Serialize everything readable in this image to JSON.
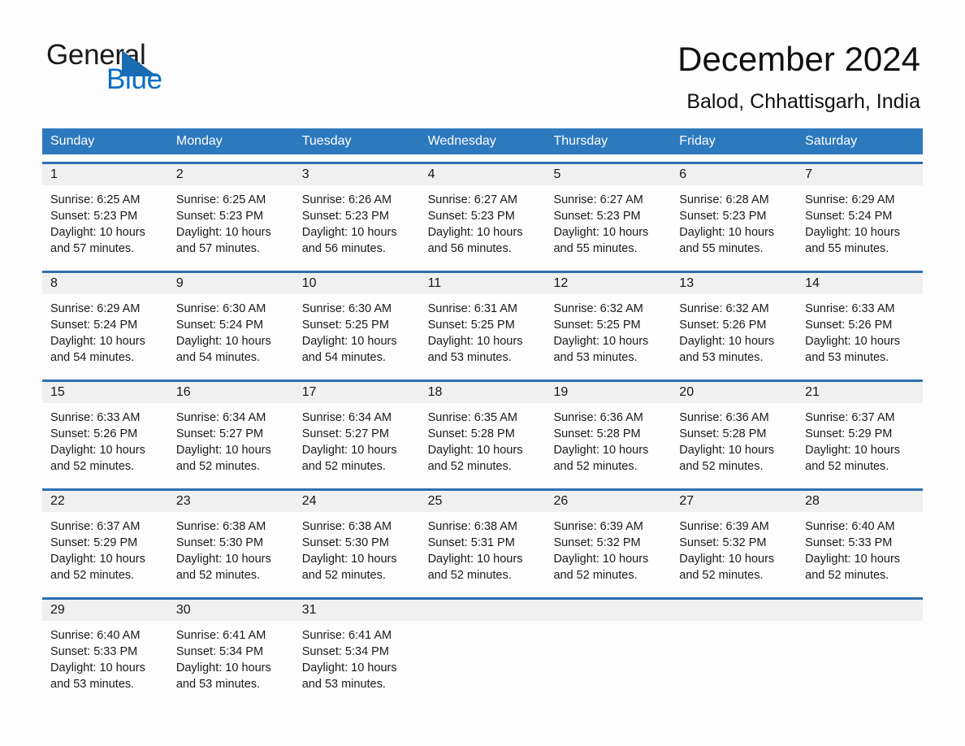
{
  "brand": {
    "name_part1": "General",
    "name_part2": "Blue"
  },
  "header": {
    "title": "December 2024",
    "location": "Balod, Chhattisgarh, India"
  },
  "calendar": {
    "weekdays": [
      "Sunday",
      "Monday",
      "Tuesday",
      "Wednesday",
      "Thursday",
      "Friday",
      "Saturday"
    ],
    "accent_color": "#2d79bd",
    "row_border_color": "#2d6faf",
    "daynum_bg": "#f0f0f0",
    "weeks": [
      {
        "daynums": [
          "1",
          "2",
          "3",
          "4",
          "5",
          "6",
          "7"
        ],
        "days": [
          {
            "sunrise": "Sunrise: 6:25 AM",
            "sunset": "Sunset: 5:23 PM",
            "daylight1": "Daylight: 10 hours",
            "daylight2": "and 57 minutes."
          },
          {
            "sunrise": "Sunrise: 6:25 AM",
            "sunset": "Sunset: 5:23 PM",
            "daylight1": "Daylight: 10 hours",
            "daylight2": "and 57 minutes."
          },
          {
            "sunrise": "Sunrise: 6:26 AM",
            "sunset": "Sunset: 5:23 PM",
            "daylight1": "Daylight: 10 hours",
            "daylight2": "and 56 minutes."
          },
          {
            "sunrise": "Sunrise: 6:27 AM",
            "sunset": "Sunset: 5:23 PM",
            "daylight1": "Daylight: 10 hours",
            "daylight2": "and 56 minutes."
          },
          {
            "sunrise": "Sunrise: 6:27 AM",
            "sunset": "Sunset: 5:23 PM",
            "daylight1": "Daylight: 10 hours",
            "daylight2": "and 55 minutes."
          },
          {
            "sunrise": "Sunrise: 6:28 AM",
            "sunset": "Sunset: 5:23 PM",
            "daylight1": "Daylight: 10 hours",
            "daylight2": "and 55 minutes."
          },
          {
            "sunrise": "Sunrise: 6:29 AM",
            "sunset": "Sunset: 5:24 PM",
            "daylight1": "Daylight: 10 hours",
            "daylight2": "and 55 minutes."
          }
        ]
      },
      {
        "daynums": [
          "8",
          "9",
          "10",
          "11",
          "12",
          "13",
          "14"
        ],
        "days": [
          {
            "sunrise": "Sunrise: 6:29 AM",
            "sunset": "Sunset: 5:24 PM",
            "daylight1": "Daylight: 10 hours",
            "daylight2": "and 54 minutes."
          },
          {
            "sunrise": "Sunrise: 6:30 AM",
            "sunset": "Sunset: 5:24 PM",
            "daylight1": "Daylight: 10 hours",
            "daylight2": "and 54 minutes."
          },
          {
            "sunrise": "Sunrise: 6:30 AM",
            "sunset": "Sunset: 5:25 PM",
            "daylight1": "Daylight: 10 hours",
            "daylight2": "and 54 minutes."
          },
          {
            "sunrise": "Sunrise: 6:31 AM",
            "sunset": "Sunset: 5:25 PM",
            "daylight1": "Daylight: 10 hours",
            "daylight2": "and 53 minutes."
          },
          {
            "sunrise": "Sunrise: 6:32 AM",
            "sunset": "Sunset: 5:25 PM",
            "daylight1": "Daylight: 10 hours",
            "daylight2": "and 53 minutes."
          },
          {
            "sunrise": "Sunrise: 6:32 AM",
            "sunset": "Sunset: 5:26 PM",
            "daylight1": "Daylight: 10 hours",
            "daylight2": "and 53 minutes."
          },
          {
            "sunrise": "Sunrise: 6:33 AM",
            "sunset": "Sunset: 5:26 PM",
            "daylight1": "Daylight: 10 hours",
            "daylight2": "and 53 minutes."
          }
        ]
      },
      {
        "daynums": [
          "15",
          "16",
          "17",
          "18",
          "19",
          "20",
          "21"
        ],
        "days": [
          {
            "sunrise": "Sunrise: 6:33 AM",
            "sunset": "Sunset: 5:26 PM",
            "daylight1": "Daylight: 10 hours",
            "daylight2": "and 52 minutes."
          },
          {
            "sunrise": "Sunrise: 6:34 AM",
            "sunset": "Sunset: 5:27 PM",
            "daylight1": "Daylight: 10 hours",
            "daylight2": "and 52 minutes."
          },
          {
            "sunrise": "Sunrise: 6:34 AM",
            "sunset": "Sunset: 5:27 PM",
            "daylight1": "Daylight: 10 hours",
            "daylight2": "and 52 minutes."
          },
          {
            "sunrise": "Sunrise: 6:35 AM",
            "sunset": "Sunset: 5:28 PM",
            "daylight1": "Daylight: 10 hours",
            "daylight2": "and 52 minutes."
          },
          {
            "sunrise": "Sunrise: 6:36 AM",
            "sunset": "Sunset: 5:28 PM",
            "daylight1": "Daylight: 10 hours",
            "daylight2": "and 52 minutes."
          },
          {
            "sunrise": "Sunrise: 6:36 AM",
            "sunset": "Sunset: 5:28 PM",
            "daylight1": "Daylight: 10 hours",
            "daylight2": "and 52 minutes."
          },
          {
            "sunrise": "Sunrise: 6:37 AM",
            "sunset": "Sunset: 5:29 PM",
            "daylight1": "Daylight: 10 hours",
            "daylight2": "and 52 minutes."
          }
        ]
      },
      {
        "daynums": [
          "22",
          "23",
          "24",
          "25",
          "26",
          "27",
          "28"
        ],
        "days": [
          {
            "sunrise": "Sunrise: 6:37 AM",
            "sunset": "Sunset: 5:29 PM",
            "daylight1": "Daylight: 10 hours",
            "daylight2": "and 52 minutes."
          },
          {
            "sunrise": "Sunrise: 6:38 AM",
            "sunset": "Sunset: 5:30 PM",
            "daylight1": "Daylight: 10 hours",
            "daylight2": "and 52 minutes."
          },
          {
            "sunrise": "Sunrise: 6:38 AM",
            "sunset": "Sunset: 5:30 PM",
            "daylight1": "Daylight: 10 hours",
            "daylight2": "and 52 minutes."
          },
          {
            "sunrise": "Sunrise: 6:38 AM",
            "sunset": "Sunset: 5:31 PM",
            "daylight1": "Daylight: 10 hours",
            "daylight2": "and 52 minutes."
          },
          {
            "sunrise": "Sunrise: 6:39 AM",
            "sunset": "Sunset: 5:32 PM",
            "daylight1": "Daylight: 10 hours",
            "daylight2": "and 52 minutes."
          },
          {
            "sunrise": "Sunrise: 6:39 AM",
            "sunset": "Sunset: 5:32 PM",
            "daylight1": "Daylight: 10 hours",
            "daylight2": "and 52 minutes."
          },
          {
            "sunrise": "Sunrise: 6:40 AM",
            "sunset": "Sunset: 5:33 PM",
            "daylight1": "Daylight: 10 hours",
            "daylight2": "and 52 minutes."
          }
        ]
      },
      {
        "daynums": [
          "29",
          "30",
          "31",
          "",
          "",
          "",
          ""
        ],
        "days": [
          {
            "sunrise": "Sunrise: 6:40 AM",
            "sunset": "Sunset: 5:33 PM",
            "daylight1": "Daylight: 10 hours",
            "daylight2": "and 53 minutes."
          },
          {
            "sunrise": "Sunrise: 6:41 AM",
            "sunset": "Sunset: 5:34 PM",
            "daylight1": "Daylight: 10 hours",
            "daylight2": "and 53 minutes."
          },
          {
            "sunrise": "Sunrise: 6:41 AM",
            "sunset": "Sunset: 5:34 PM",
            "daylight1": "Daylight: 10 hours",
            "daylight2": "and 53 minutes."
          },
          {
            "sunrise": "",
            "sunset": "",
            "daylight1": "",
            "daylight2": ""
          },
          {
            "sunrise": "",
            "sunset": "",
            "daylight1": "",
            "daylight2": ""
          },
          {
            "sunrise": "",
            "sunset": "",
            "daylight1": "",
            "daylight2": ""
          },
          {
            "sunrise": "",
            "sunset": "",
            "daylight1": "",
            "daylight2": ""
          }
        ]
      }
    ]
  }
}
